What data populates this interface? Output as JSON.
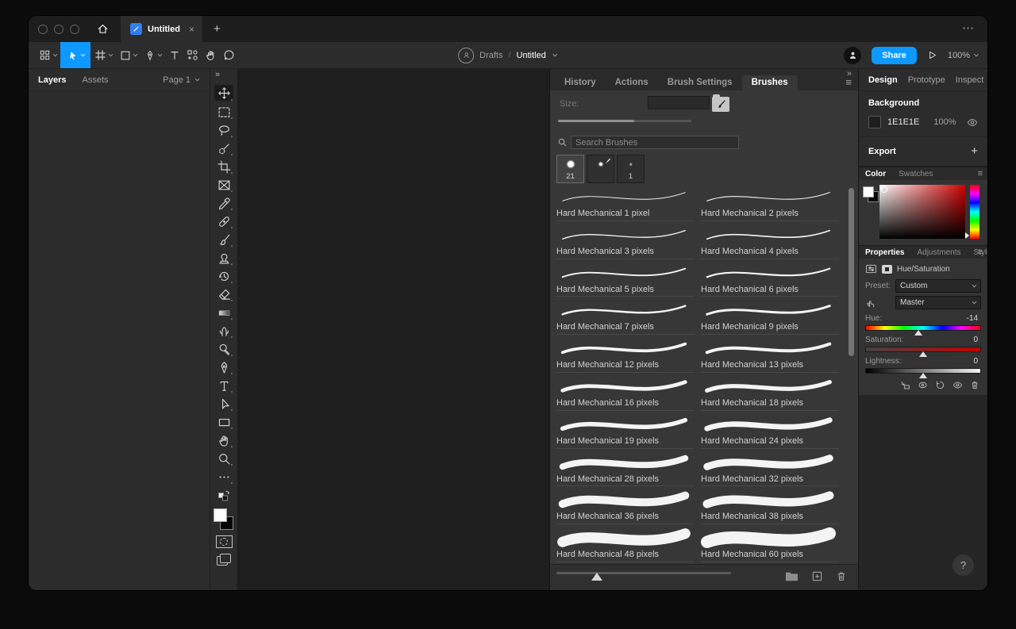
{
  "glyphs": {
    "close": "×",
    "new_tab": "+",
    "more": "⋯",
    "collapse": "»",
    "menu": "≡",
    "help": "?",
    "plus": "+"
  },
  "colors": {
    "accent": "#0d99ff",
    "canvas": "#1e1e1e",
    "file_icon_blue": "#2f80ed"
  },
  "tabbar": {
    "tab_title": "Untitled"
  },
  "toolbar": {
    "breadcrumb": {
      "project": "Drafts",
      "separator": "/",
      "file": "Untitled"
    },
    "share_label": "Share",
    "zoom_level": "100%"
  },
  "left_panel": {
    "tab_layers": "Layers",
    "tab_assets": "Assets",
    "page_selector": "Page 1"
  },
  "ps_toolbar": {
    "tools": [
      {
        "id": "move-tool",
        "selected": true
      },
      {
        "id": "marquee-tool"
      },
      {
        "id": "lasso-tool"
      },
      {
        "id": "quick-selection-tool"
      },
      {
        "id": "crop-tool"
      },
      {
        "id": "slice-tool"
      },
      {
        "id": "eyedropper-tool"
      },
      {
        "id": "healing-brush-tool"
      },
      {
        "id": "brush-tool"
      },
      {
        "id": "clone-stamp-tool"
      },
      {
        "id": "history-brush-tool"
      },
      {
        "id": "eraser-tool"
      },
      {
        "id": "gradient-tool"
      },
      {
        "id": "smudge-tool"
      },
      {
        "id": "dodge-tool"
      },
      {
        "id": "pen-tool"
      },
      {
        "id": "type-tool"
      },
      {
        "id": "path-select-tool"
      },
      {
        "id": "rectangle-tool"
      },
      {
        "id": "hand-tool"
      },
      {
        "id": "zoom-tool"
      },
      {
        "id": "more-tools"
      }
    ]
  },
  "brushes_panel": {
    "tabs": [
      "History",
      "Actions",
      "Brush Settings",
      "Brushes"
    ],
    "active_tab": "Brushes",
    "size_label": "Size:",
    "size_value": "",
    "search_placeholder": "Search Brushes",
    "recent_brushes": [
      {
        "label": "21",
        "selected": true
      },
      {
        "label": "",
        "cursor": true
      },
      {
        "label": "1"
      }
    ],
    "brushes": [
      {
        "name": "Hard Mechanical 1 pixel",
        "size": 1
      },
      {
        "name": "Hard Mechanical 2 pixels",
        "size": 2
      },
      {
        "name": "Hard Mechanical 3 pixels",
        "size": 3
      },
      {
        "name": "Hard Mechanical 4 pixels",
        "size": 4
      },
      {
        "name": "Hard Mechanical 5 pixels",
        "size": 5
      },
      {
        "name": "Hard Mechanical 6 pixels",
        "size": 6
      },
      {
        "name": "Hard Mechanical 7 pixels",
        "size": 7
      },
      {
        "name": "Hard Mechanical 9 pixels",
        "size": 9
      },
      {
        "name": "Hard Mechanical 12 pixels",
        "size": 12
      },
      {
        "name": "Hard Mechanical 13 pixels",
        "size": 13
      },
      {
        "name": "Hard Mechanical 16 pixels",
        "size": 16
      },
      {
        "name": "Hard Mechanical 18 pixels",
        "size": 18
      },
      {
        "name": "Hard Mechanical 19 pixels",
        "size": 19
      },
      {
        "name": "Hard Mechanical 24 pixels",
        "size": 24
      },
      {
        "name": "Hard Mechanical 28 pixels",
        "size": 28
      },
      {
        "name": "Hard Mechanical 32 pixels",
        "size": 32
      },
      {
        "name": "Hard Mechanical 36 pixels",
        "size": 36
      },
      {
        "name": "Hard Mechanical 38 pixels",
        "size": 38
      },
      {
        "name": "Hard Mechanical 48 pixels",
        "size": 48
      },
      {
        "name": "Hard Mechanical 60 pixels",
        "size": 60
      }
    ]
  },
  "right_panel": {
    "tabs": [
      "Design",
      "Prototype",
      "Inspect"
    ],
    "active_tab": "Design",
    "background": {
      "title": "Background",
      "hex": "1E1E1E",
      "opacity": "100%"
    },
    "export_title": "Export",
    "color_panel": {
      "tab_color": "Color",
      "tab_swatches": "Swatches"
    },
    "properties_panel": {
      "tab_properties": "Properties",
      "tab_adjustments": "Adjustments",
      "tab_styles": "Styles",
      "adjustment_title": "Hue/Saturation",
      "preset_label": "Preset:",
      "preset_value": "Custom",
      "channel_value": "Master",
      "hue_label": "Hue:",
      "hue_value": "-14",
      "hue_percent": 46.1,
      "saturation_label": "Saturation:",
      "saturation_value": "0",
      "saturation_percent": 50,
      "lightness_label": "Lightness:",
      "lightness_value": "0",
      "lightness_percent": 50
    }
  }
}
